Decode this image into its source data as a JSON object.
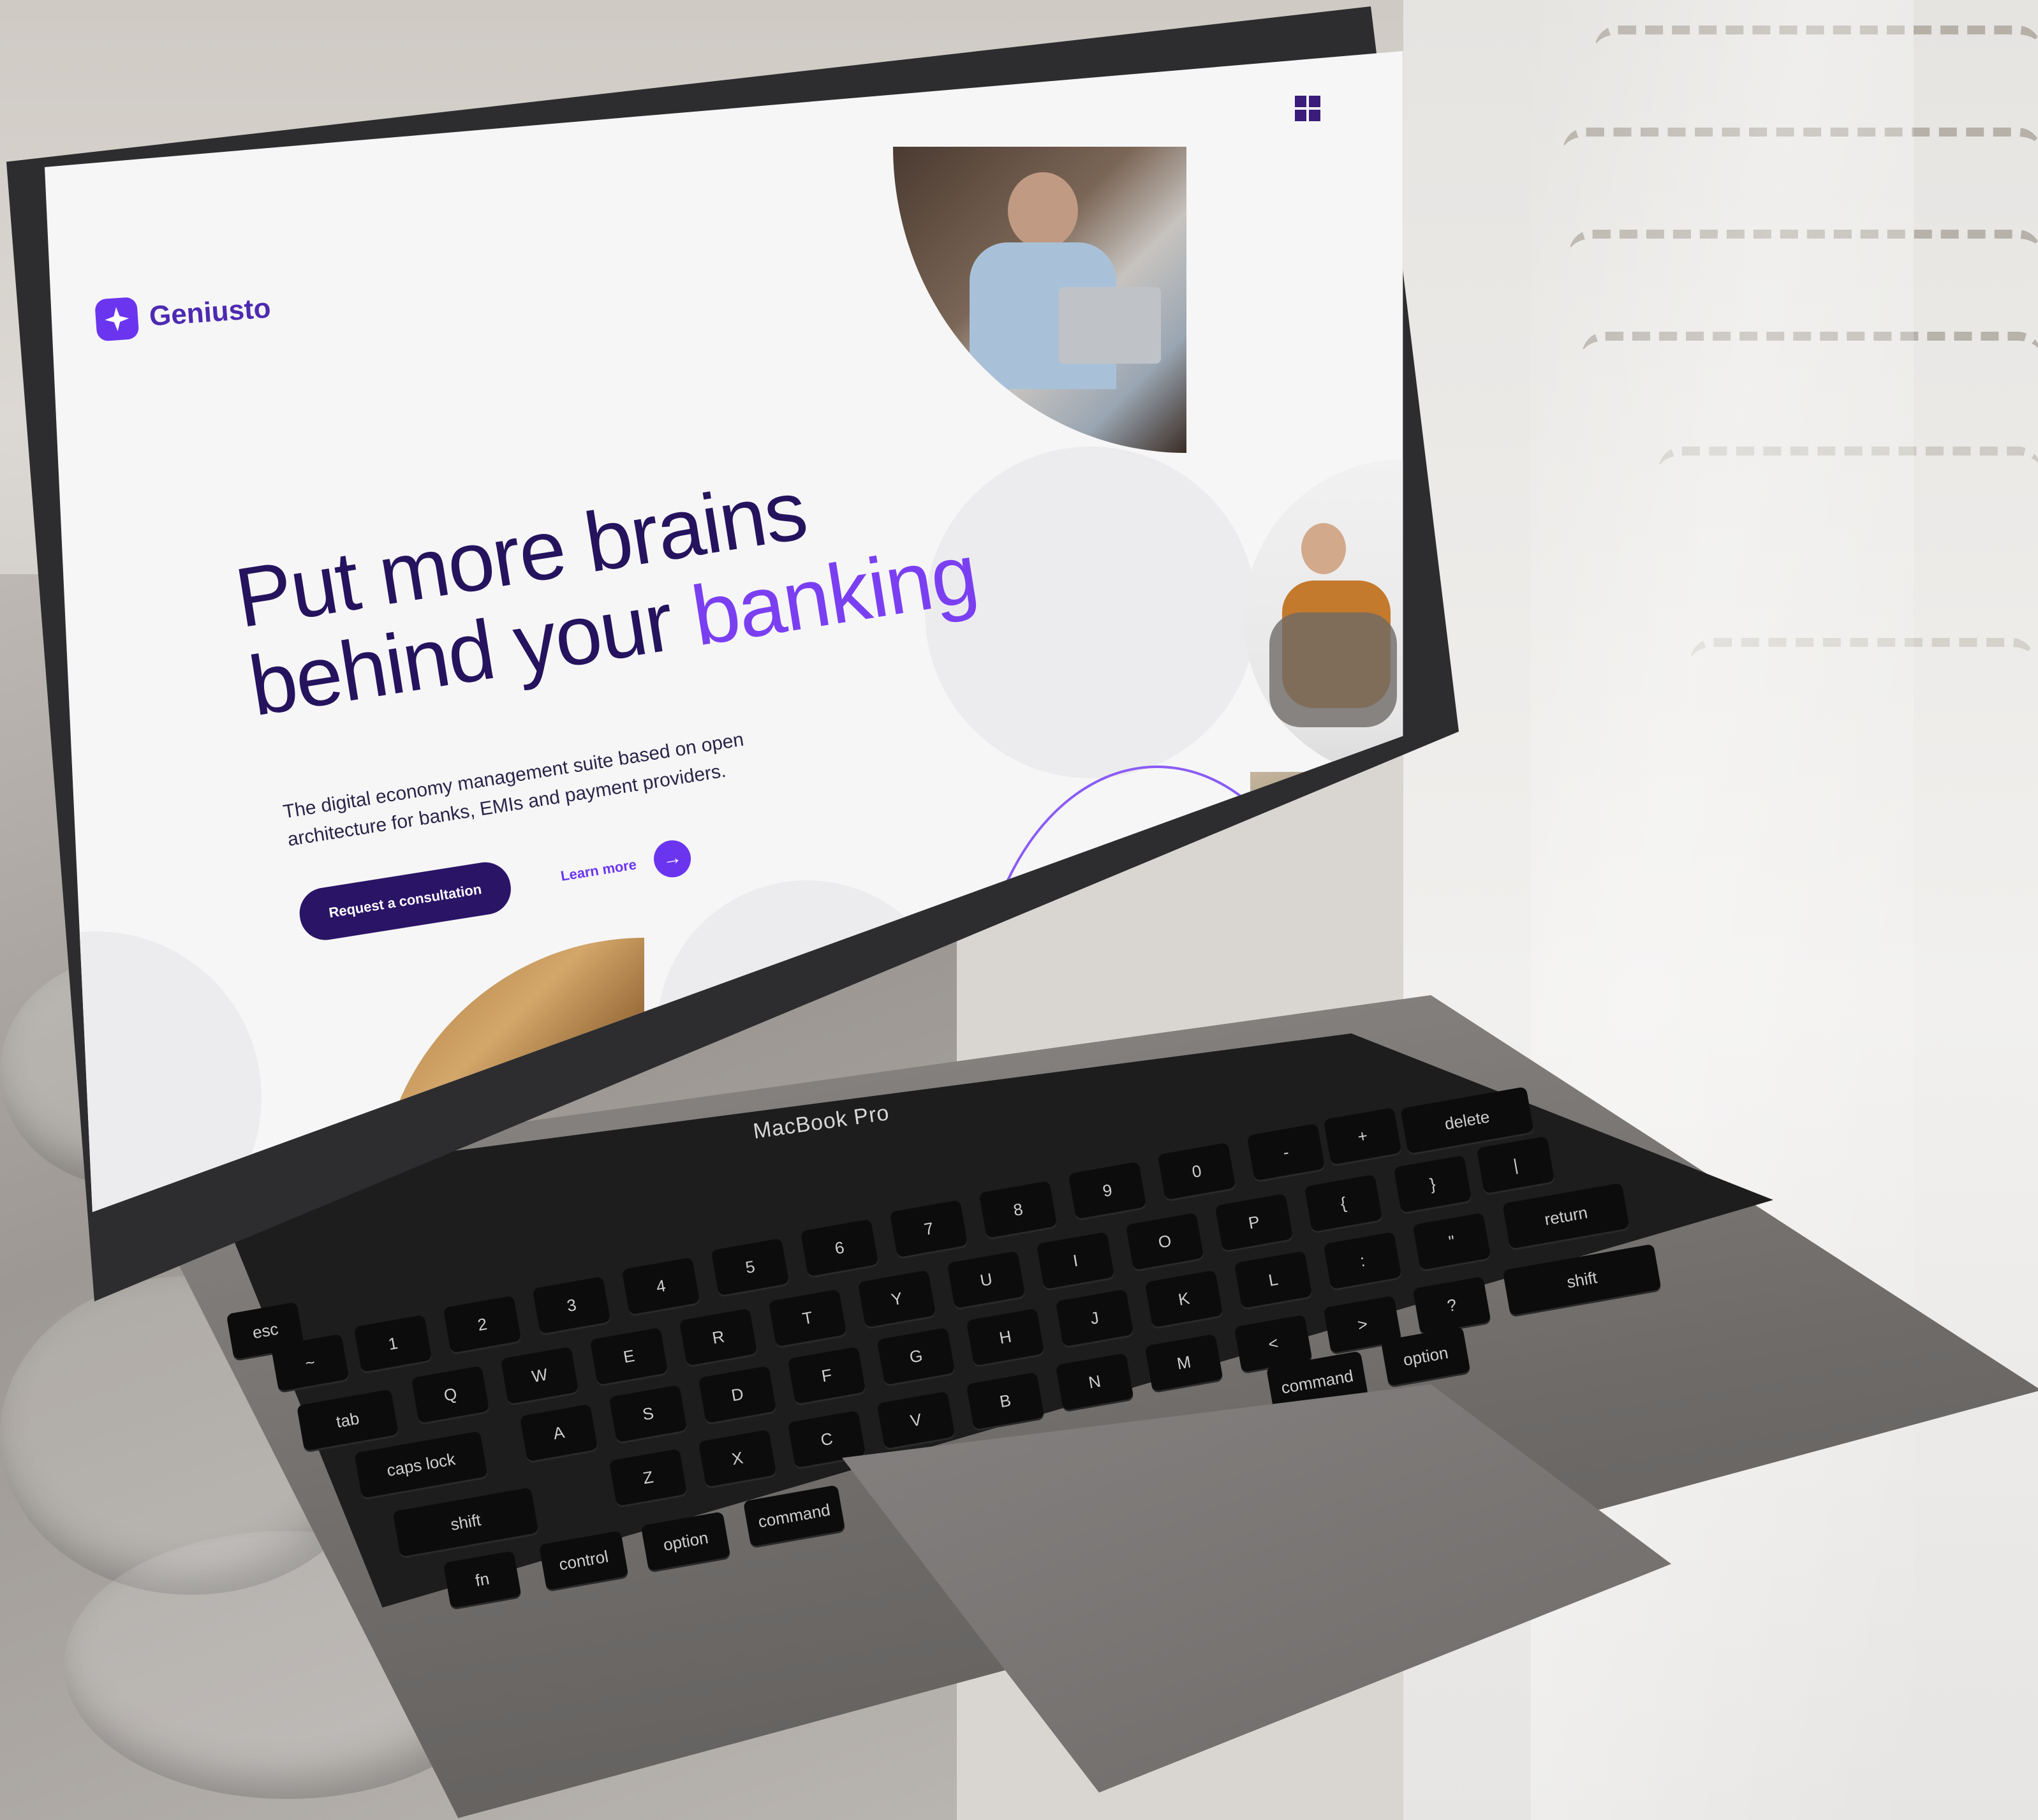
{
  "site": {
    "brand": "Geniusto",
    "headline_line1": "Put more brains",
    "headline_line2_start": "behind your ",
    "headline_accent": "banking",
    "subtitle": "The digital economy management suite based on open architecture for banks, EMIs and payment providers.",
    "cta_primary": "Request a consultation",
    "cta_secondary": "Learn more",
    "arrow_glyph": "→"
  },
  "device": {
    "label": "MacBook Pro"
  },
  "keyboard": {
    "keys": [
      "esc",
      "~",
      "1",
      "2",
      "3",
      "4",
      "5",
      "6",
      "7",
      "8",
      "9",
      "0",
      "-",
      "+",
      "delete",
      "tab",
      "Q",
      "W",
      "E",
      "R",
      "T",
      "Y",
      "U",
      "I",
      "O",
      "P",
      "{",
      "}",
      "|",
      "caps lock",
      "A",
      "S",
      "D",
      "F",
      "G",
      "H",
      "J",
      "K",
      "L",
      ":",
      "\"",
      "return",
      "shift",
      "Z",
      "X",
      "C",
      "V",
      "B",
      "N",
      "M",
      "<",
      ">",
      "?",
      "shift",
      "fn",
      "control",
      "option",
      "command",
      "command",
      "option"
    ]
  },
  "colors": {
    "brand": "#6b35f0",
    "headline": "#25135e",
    "button": "#2a1466"
  },
  "icons": {
    "logo": "star-icon",
    "menu": "grid-icon",
    "arrow": "arrow-right-icon"
  }
}
